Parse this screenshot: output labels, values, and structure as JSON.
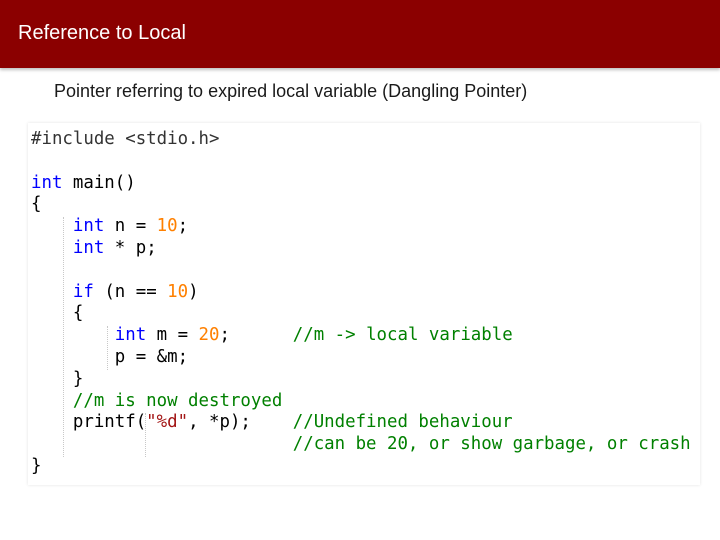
{
  "slide": {
    "title": "Reference to Local",
    "subtitle": "Pointer referring to expired local variable (Dangling Pointer)"
  },
  "code": {
    "lines": [
      [
        {
          "t": "#include <stdio.h>",
          "c": "pre"
        }
      ],
      [],
      [
        {
          "t": "int",
          "c": "kw"
        },
        {
          "t": " main()",
          "c": ""
        }
      ],
      [
        {
          "t": "{",
          "c": ""
        }
      ],
      [
        {
          "t": "    ",
          "c": ""
        },
        {
          "t": "int",
          "c": "kw"
        },
        {
          "t": " n = ",
          "c": ""
        },
        {
          "t": "10",
          "c": "num"
        },
        {
          "t": ";",
          "c": ""
        }
      ],
      [
        {
          "t": "    ",
          "c": ""
        },
        {
          "t": "int",
          "c": "kw"
        },
        {
          "t": " * p;",
          "c": ""
        }
      ],
      [],
      [
        {
          "t": "    ",
          "c": ""
        },
        {
          "t": "if",
          "c": "kw"
        },
        {
          "t": " (n == ",
          "c": ""
        },
        {
          "t": "10",
          "c": "num"
        },
        {
          "t": ")",
          "c": ""
        }
      ],
      [
        {
          "t": "    {",
          "c": ""
        }
      ],
      [
        {
          "t": "        ",
          "c": ""
        },
        {
          "t": "int",
          "c": "kw"
        },
        {
          "t": " m = ",
          "c": ""
        },
        {
          "t": "20",
          "c": "num"
        },
        {
          "t": ";      ",
          "c": ""
        },
        {
          "t": "//m -> local variable",
          "c": "cmt"
        }
      ],
      [
        {
          "t": "        p = &m;",
          "c": ""
        }
      ],
      [
        {
          "t": "    }",
          "c": ""
        }
      ],
      [
        {
          "t": "    ",
          "c": ""
        },
        {
          "t": "//m is now destroyed",
          "c": "cmt"
        }
      ],
      [
        {
          "t": "    printf(",
          "c": ""
        },
        {
          "t": "\"%d\"",
          "c": "str"
        },
        {
          "t": ", *p);    ",
          "c": ""
        },
        {
          "t": "//Undefined behaviour",
          "c": "cmt"
        }
      ],
      [
        {
          "t": "                         ",
          "c": ""
        },
        {
          "t": "//can be 20, or show garbage, or crash",
          "c": "cmt"
        }
      ],
      [
        {
          "t": "}",
          "c": ""
        }
      ]
    ]
  }
}
